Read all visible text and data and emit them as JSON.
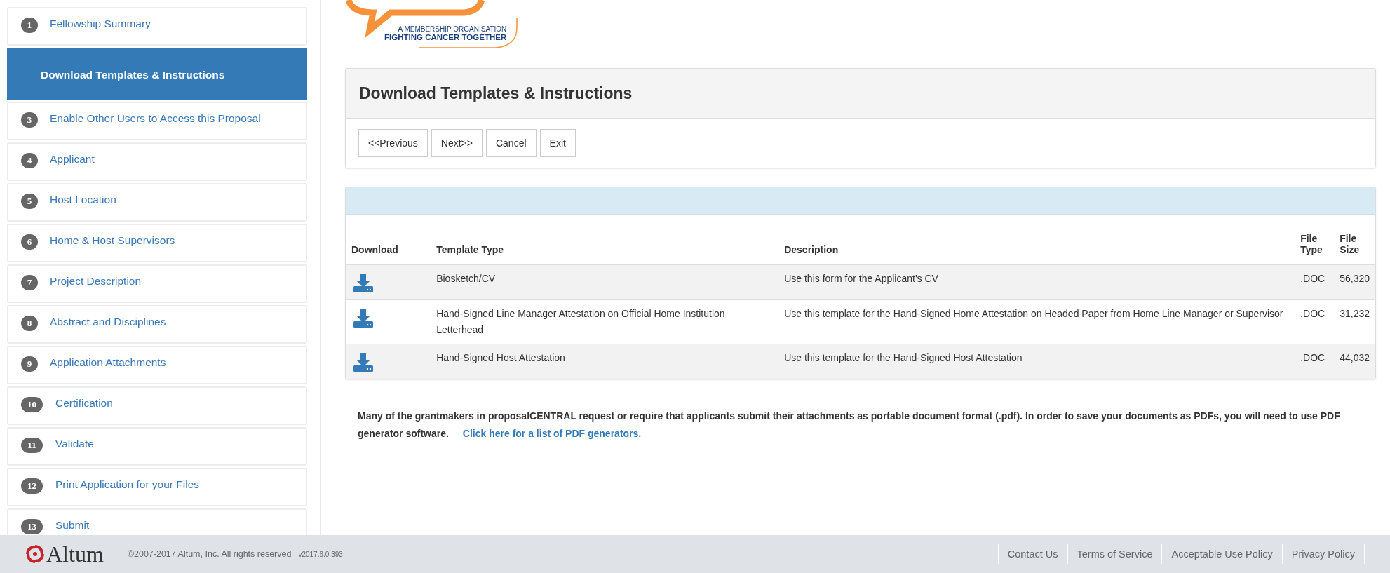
{
  "sidebar": {
    "items": [
      {
        "number": "1",
        "label": "Fellowship Summary",
        "selected": false
      },
      {
        "label": "Download Templates & Instructions",
        "selected": true
      },
      {
        "number": "3",
        "label": "Enable Other Users to Access this Proposal",
        "selected": false
      },
      {
        "number": "4",
        "label": "Applicant",
        "selected": false
      },
      {
        "number": "5",
        "label": "Host Location",
        "selected": false
      },
      {
        "number": "6",
        "label": "Home & Host Supervisors",
        "selected": false
      },
      {
        "number": "7",
        "label": "Project Description",
        "selected": false
      },
      {
        "number": "8",
        "label": "Abstract and Disciplines",
        "selected": false
      },
      {
        "number": "9",
        "label": "Application Attachments",
        "selected": false
      },
      {
        "number": "10",
        "label": "Certification",
        "selected": false
      },
      {
        "number": "11",
        "label": "Validate",
        "selected": false
      },
      {
        "number": "12",
        "label": "Print Application for your Files",
        "selected": false
      },
      {
        "number": "13",
        "label": "Submit",
        "selected": false
      }
    ]
  },
  "logo": {
    "tagline": "A MEMBERSHIP ORGANISATION",
    "slogan": "FIGHTING CANCER TOGETHER"
  },
  "page": {
    "title": "Download Templates & Instructions",
    "buttons": [
      "<<Previous",
      "Next>>",
      "Cancel",
      "Exit"
    ]
  },
  "table": {
    "columns": [
      "Download",
      "Template Type",
      "Description",
      "File Type",
      "File Size"
    ],
    "rows": [
      {
        "template_type": "Biosketch/CV",
        "description": "Use this form for the Applicant's CV",
        "file_type": ".DOC",
        "file_size": "56,320"
      },
      {
        "template_type": "Hand-Signed Line Manager Attestation on Official Home Institution Letterhead",
        "description": "Use this template for the Hand-Signed Home Attestation on Headed Paper from Home Line Manager or Supervisor",
        "file_type": ".DOC",
        "file_size": "31,232"
      },
      {
        "template_type": "Hand-Signed Host Attestation",
        "description": "Use this template for the Hand-Signed Host Attestation",
        "file_type": ".DOC",
        "file_size": "44,032"
      }
    ]
  },
  "note": {
    "text": "Many of the grantmakers in proposalCENTRAL request or require that applicants submit their attachments as portable document format (.pdf). In order to save your documents as PDFs, you will need to use PDF generator software.",
    "link": "Click here for a list of PDF generators."
  },
  "footer": {
    "brand": "Altum",
    "copyright": "©2007-2017 Altum, Inc. All rights reserved",
    "version": "v2017.6.0.393",
    "links": [
      "Contact Us",
      "Terms of Service",
      "Acceptable Use Policy",
      "Privacy Policy"
    ]
  }
}
